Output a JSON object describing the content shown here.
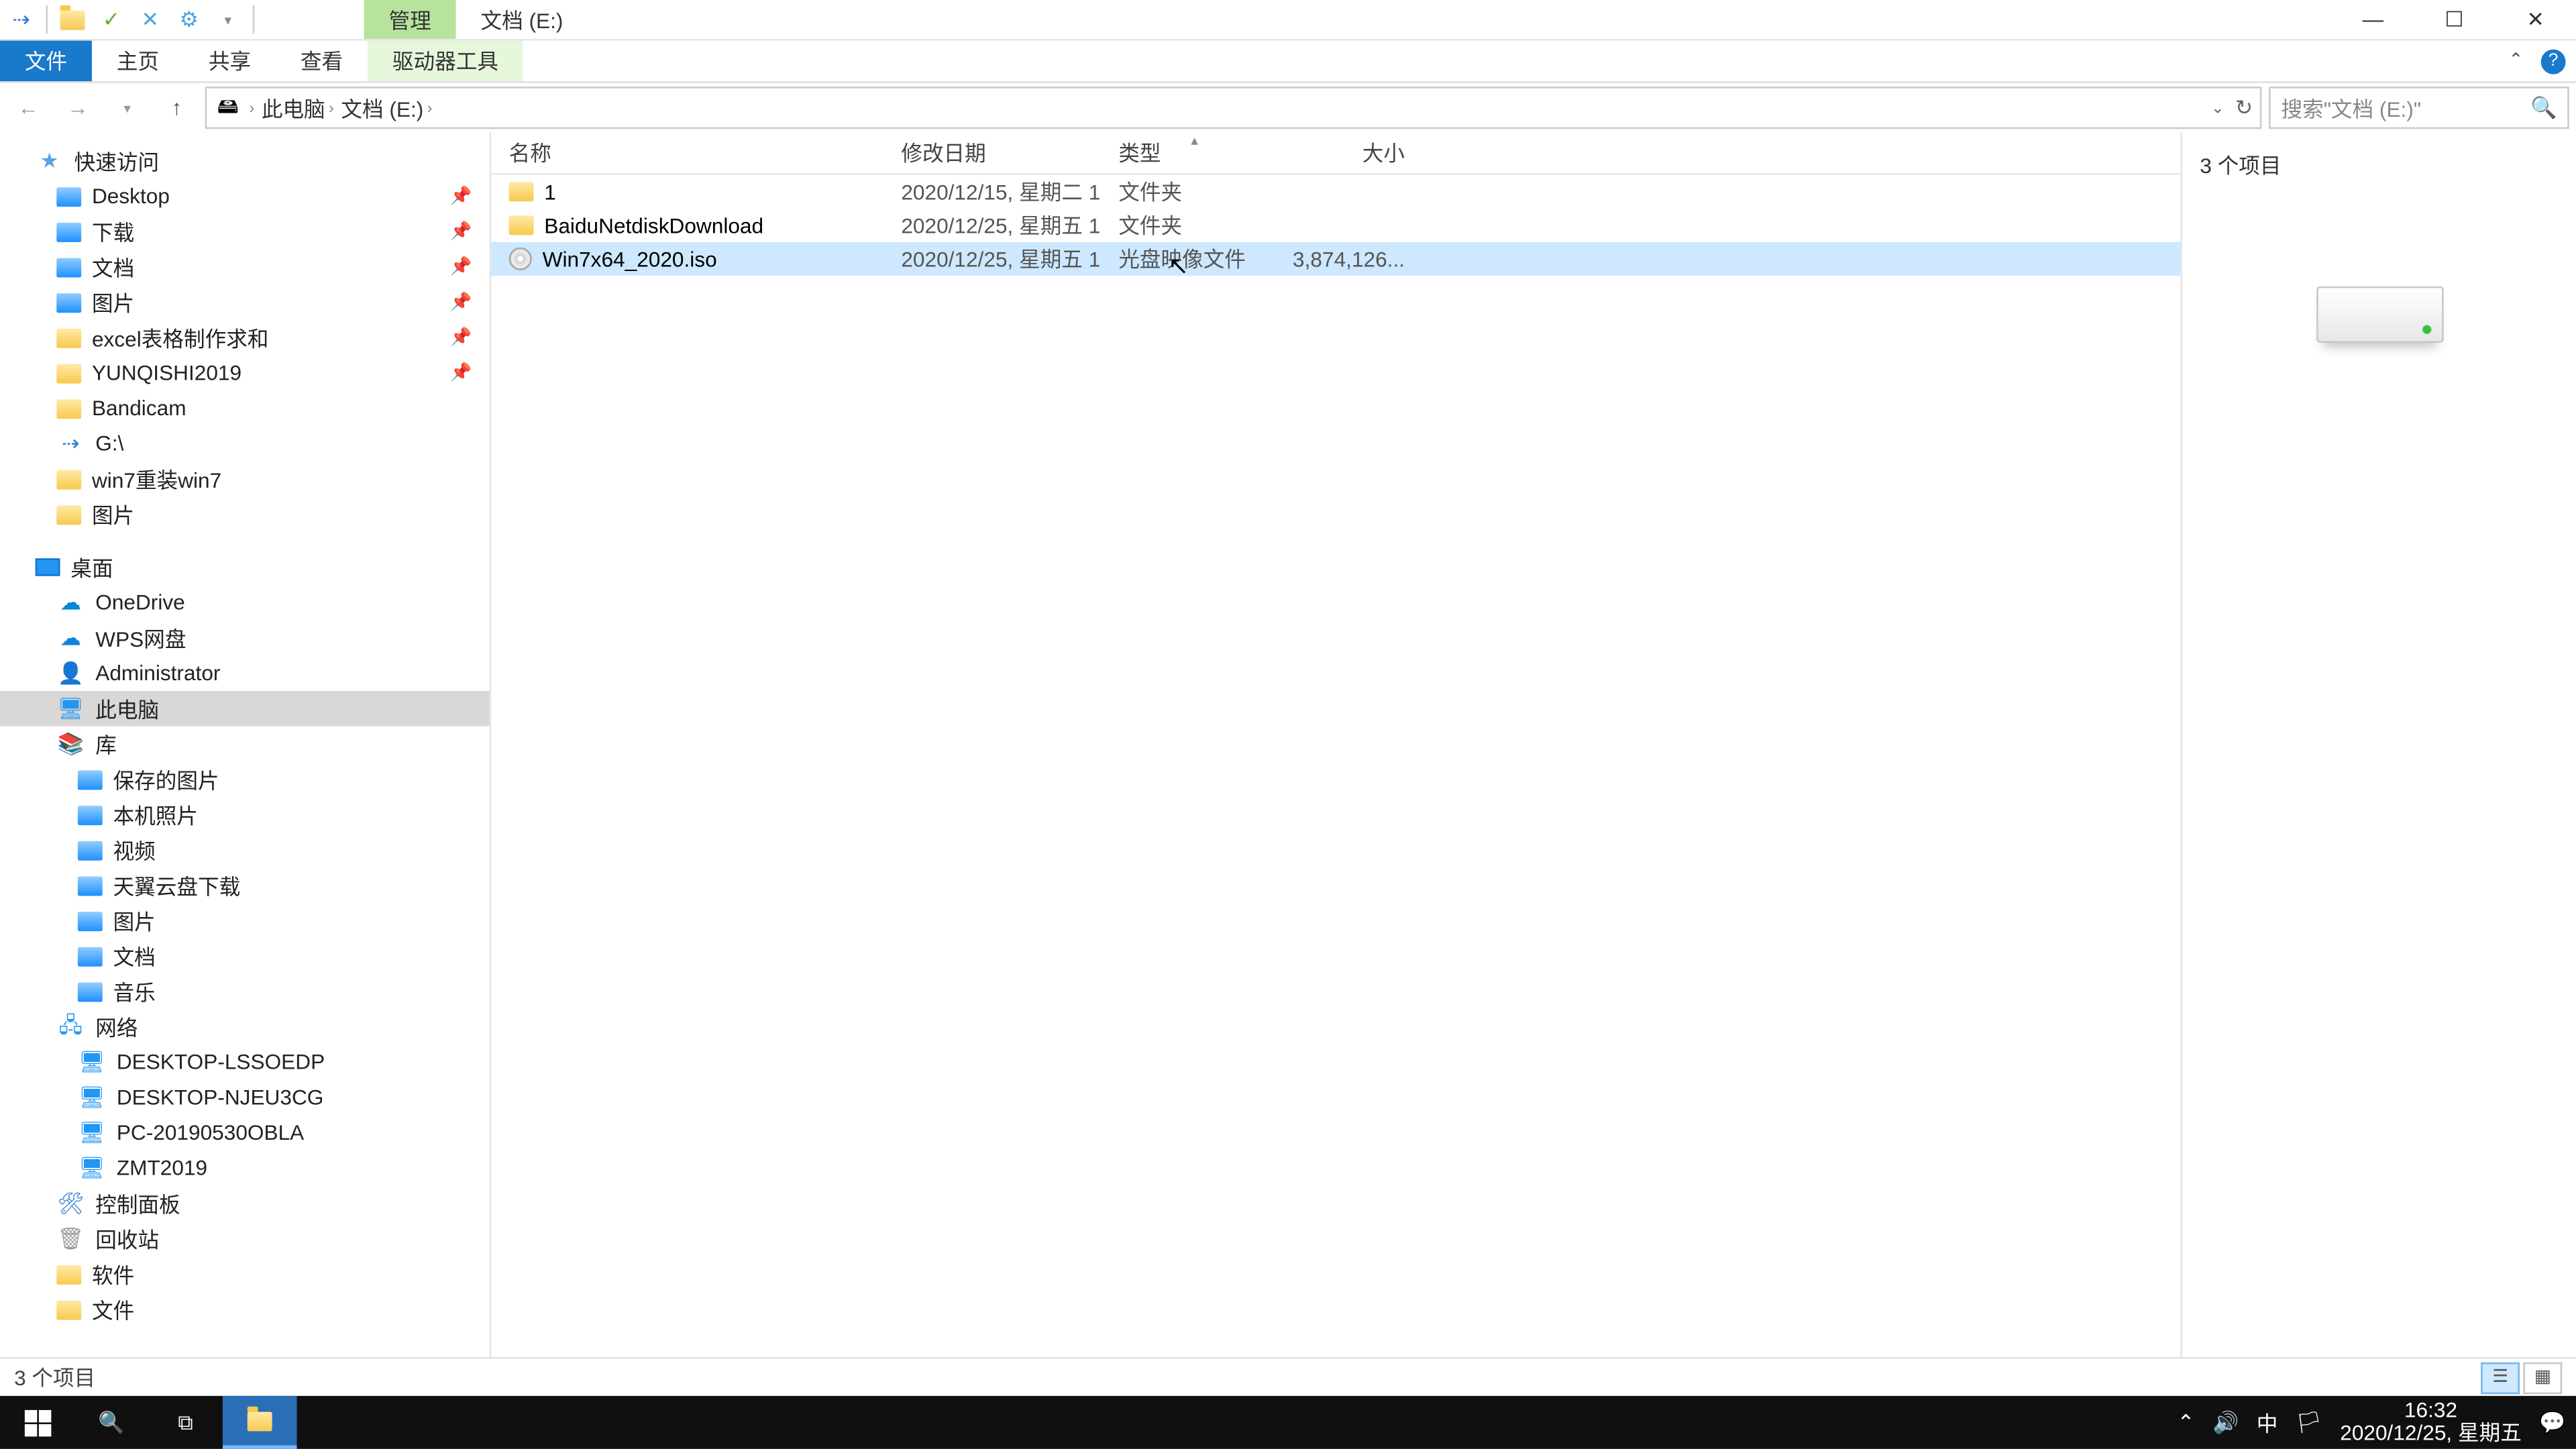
{
  "titlebar": {
    "contextTab": "管理",
    "locationTab": "文档 (E:)"
  },
  "ribbon": {
    "file": "文件",
    "tabs": [
      "主页",
      "共享",
      "查看"
    ],
    "context": "驱动器工具"
  },
  "address": {
    "crumbs": [
      "此电脑",
      "文档 (E:)"
    ]
  },
  "search": {
    "placeholder": "搜索\"文档 (E:)\""
  },
  "nav": {
    "quickAccess": "快速访问",
    "pinned": [
      {
        "label": "Desktop"
      },
      {
        "label": "下载"
      },
      {
        "label": "文档"
      },
      {
        "label": "图片"
      },
      {
        "label": "excel表格制作求和"
      },
      {
        "label": "YUNQISHI2019"
      },
      {
        "label": "Bandicam"
      },
      {
        "label": "G:\\"
      },
      {
        "label": "win7重装win7"
      },
      {
        "label": "图片"
      }
    ],
    "desktop": "桌面",
    "cloud": [
      "OneDrive",
      "WPS网盘"
    ],
    "user": "Administrator",
    "thisPC": "此电脑",
    "libraries": "库",
    "libItems": [
      "保存的图片",
      "本机照片",
      "视频",
      "天翼云盘下载",
      "图片",
      "文档",
      "音乐"
    ],
    "network": "网络",
    "netItems": [
      "DESKTOP-LSSOEDP",
      "DESKTOP-NJEU3CG",
      "PC-20190530OBLA",
      "ZMT2019"
    ],
    "controlPanel": "控制面板",
    "recycle": "回收站",
    "software": "软件",
    "docs": "文件"
  },
  "columns": {
    "name": "名称",
    "date": "修改日期",
    "type": "类型",
    "size": "大小"
  },
  "files": [
    {
      "name": "1",
      "date": "2020/12/15, 星期二 1...",
      "type": "文件夹",
      "size": "",
      "icon": "folder"
    },
    {
      "name": "BaiduNetdiskDownload",
      "date": "2020/12/25, 星期五 1...",
      "type": "文件夹",
      "size": "",
      "icon": "folder"
    },
    {
      "name": "Win7x64_2020.iso",
      "date": "2020/12/25, 星期五 1...",
      "type": "光盘映像文件",
      "size": "3,874,126...",
      "icon": "disc",
      "selected": true
    }
  ],
  "preview": {
    "summary": "3 个项目"
  },
  "status": {
    "text": "3 个项目"
  },
  "taskbar": {
    "time": "16:32",
    "date": "2020/12/25, 星期五",
    "ime": "中"
  }
}
